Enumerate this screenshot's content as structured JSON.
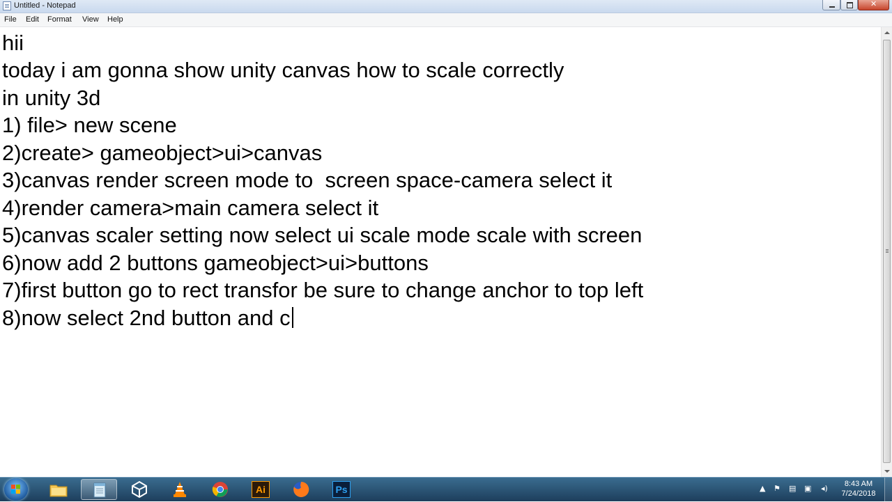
{
  "window": {
    "title": "Untitled - Notepad"
  },
  "menu": {
    "items": [
      "File",
      "Edit",
      "Format",
      "View",
      "Help"
    ]
  },
  "editor": {
    "lines": [
      "hii",
      "today i am gonna show unity canvas how to scale correctly",
      "in unity 3d",
      "1) file> new scene",
      "2)create> gameobject>ui>canvas",
      "3)canvas render screen mode to  screen space-camera select it",
      "4)render camera>main camera select it",
      "5)canvas scaler setting now select ui scale mode scale with screen",
      "6)now add 2 buttons gameobject>ui>buttons",
      "7)first button go to rect transfor be sure to change anchor to top left",
      "8)now select 2nd button and c"
    ]
  },
  "taskbar": {
    "apps": [
      {
        "name": "explorer",
        "icon": "folder-icon"
      },
      {
        "name": "notepad",
        "icon": "notepad-icon",
        "active": true
      },
      {
        "name": "unity",
        "icon": "unity-icon"
      },
      {
        "name": "vlc",
        "icon": "vlc-cone-icon"
      },
      {
        "name": "chrome",
        "icon": "chrome-icon"
      },
      {
        "name": "illustrator",
        "icon": "illustrator-icon",
        "label": "Ai"
      },
      {
        "name": "firefox",
        "icon": "firefox-icon"
      },
      {
        "name": "photoshop",
        "icon": "photoshop-icon",
        "label": "Ps"
      }
    ],
    "clock": {
      "time": "8:43 AM",
      "date": "7/24/2018"
    }
  },
  "colors": {
    "taskbar": "#1d3e5c",
    "illustrator": "#ff9a00",
    "photoshop": "#2da0f0"
  }
}
